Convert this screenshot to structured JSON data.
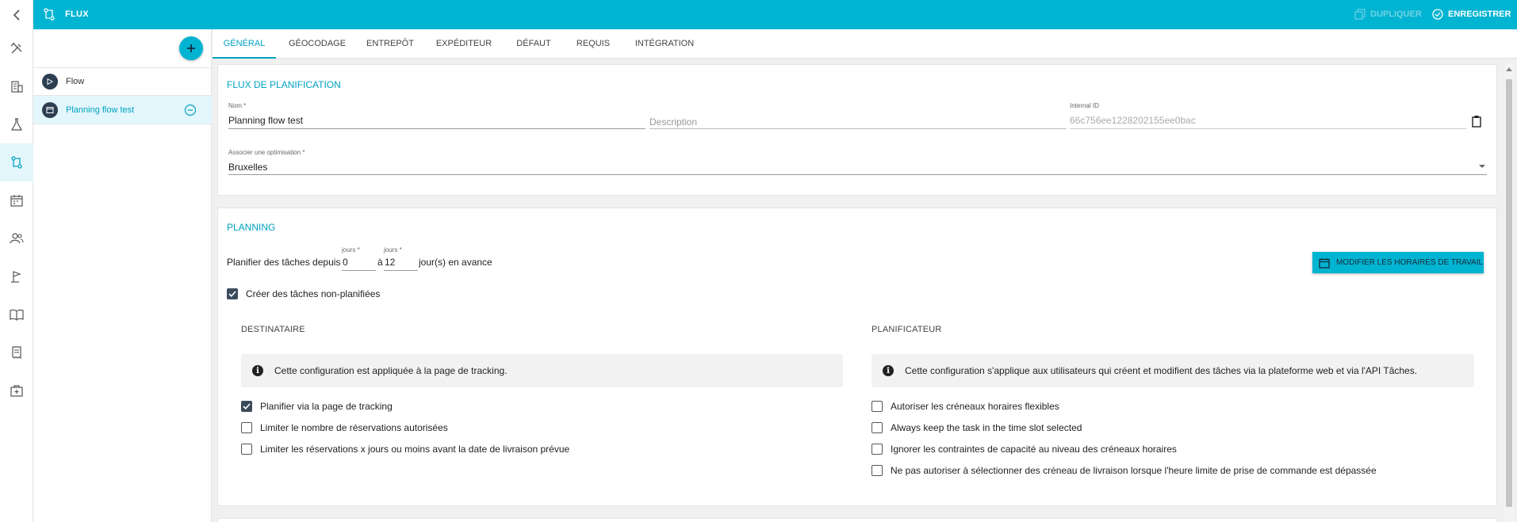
{
  "topbar": {
    "title": "FLUX",
    "duplicate_label": "DUPLIQUER",
    "save_label": "ENREGISTRER"
  },
  "rail": {
    "items": [
      "tools-icon",
      "building-icon",
      "flask-icon",
      "flow-icon",
      "calendar-icon",
      "users-icon",
      "flag-icon",
      "book-icon",
      "receipt-icon",
      "medical-box-icon"
    ],
    "active": "flow-icon"
  },
  "flows": {
    "items": [
      {
        "label": "Flow",
        "icon": "play-icon"
      },
      {
        "label": "Planning flow test",
        "icon": "window-icon",
        "selected": true
      }
    ]
  },
  "tabs": [
    "GÉNÉRAL",
    "GÉOCODAGE",
    "ENTREPÔT",
    "EXPÉDITEUR",
    "DÉFAUT",
    "REQUIS",
    "INTÉGRATION"
  ],
  "flux": {
    "title": "FLUX DE PLANIFICATION",
    "name_label": "Nom *",
    "name_value": "Planning flow test",
    "description_placeholder": "Description",
    "internal_id_label": "Internal ID",
    "internal_id_value": "66c756ee1228202155ee0bac",
    "optim_label": "Associer une optimisation *",
    "optim_value": "Bruxelles"
  },
  "planning": {
    "title": "PLANNING",
    "plan_prefix": "Planifier des tâches depuis",
    "days_label_1": "jours *",
    "days_value_1": "0",
    "to_label": "à",
    "days_label_2": "jours *",
    "days_value_2": "12",
    "plan_suffix": "jour(s) en avance",
    "work_hours_button": "MODIFIER LES HORAIRES DE TRAVAIL",
    "create_unplanned": {
      "label": "Créer des tâches non-planifiées",
      "checked": true
    },
    "recipient": {
      "title": "DESTINATAIRE",
      "info": "Cette configuration est appliquée à la page de tracking.",
      "options": [
        {
          "label": "Planifier via la page de tracking",
          "checked": true
        },
        {
          "label": "Limiter le nombre de réservations autorisées",
          "checked": false
        },
        {
          "label": "Limiter les réservations x jours ou moins avant la date de livraison prévue",
          "checked": false
        }
      ]
    },
    "planner": {
      "title": "PLANIFICATEUR",
      "info": "Cette configuration s'applique aux utilisateurs qui créent et modifient des tâches via la plateforme web et via l'API Tâches.",
      "options": [
        {
          "label": "Autoriser les créneaux horaires flexibles",
          "checked": false
        },
        {
          "label": "Always keep the task in the time slot selected",
          "checked": false
        },
        {
          "label": "Ignorer les contraintes de capacité au niveau des créneaux horaires",
          "checked": false
        },
        {
          "label": "Ne pas autoriser à sélectionner des créneau de livraison lorsque l'heure limite de prise de commande est dépassée",
          "checked": false
        }
      ]
    }
  },
  "colors": {
    "accent": "#00b4d2",
    "accent_text": "#00a2c3",
    "checkbox": "#3b4b5c"
  }
}
